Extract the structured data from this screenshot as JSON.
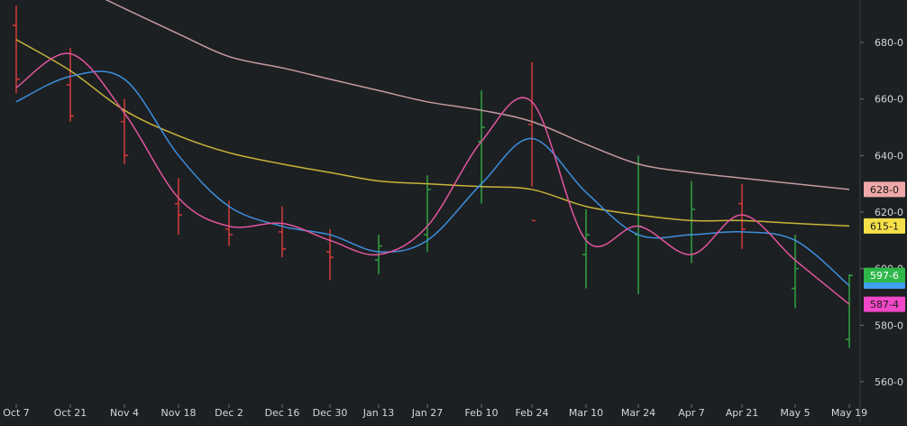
{
  "chart_data": {
    "type": "ohlc",
    "title": "",
    "xlabel": "",
    "ylabel": "",
    "ylim": [
      553,
      700
    ],
    "grid": false,
    "y_ticks": [
      {
        "value": 680,
        "label": "680-0"
      },
      {
        "value": 660,
        "label": "660-0"
      },
      {
        "value": 640,
        "label": "640-0"
      },
      {
        "value": 620,
        "label": "620-0"
      },
      {
        "value": 600,
        "label": "600-0"
      },
      {
        "value": 580,
        "label": "580-0"
      },
      {
        "value": 560,
        "label": "560-0"
      }
    ],
    "x_ticks": [
      "Oct 7",
      "Oct 21",
      "Nov 4",
      "Nov 18",
      "Dec 2",
      "Dec 16",
      "Dec 30",
      "Jan 13",
      "Jan 27",
      "Feb 10",
      "Feb 24",
      "Mar 10",
      "Mar 24",
      "Apr 7",
      "Apr 21",
      "May 5",
      "May 19"
    ],
    "last_value_labels": [
      {
        "label": "628-0",
        "value": 628.0,
        "color": "#f0a8a8"
      },
      {
        "label": "615-1",
        "value": 615.1,
        "color": "#f5e04a"
      },
      {
        "label": "597-6",
        "value": 597.6,
        "color": "#2fb84a"
      },
      {
        "label": "",
        "value": 594.0,
        "color": "#3fa0f0"
      },
      {
        "label": "587-4",
        "value": 587.4,
        "color": "#f048c8"
      }
    ],
    "series": [
      {
        "type": "line",
        "color": "#c49aa0",
        "x": [
          "Oct 7",
          "Oct 21",
          "Nov 4",
          "Nov 18",
          "Dec 2",
          "Dec 16",
          "Dec 30",
          "Jan 13",
          "Jan 27",
          "Feb 10",
          "Feb 24",
          "Mar 10",
          "Mar 24",
          "Apr 7",
          "Apr 21",
          "May 5",
          "May 19"
        ],
        "values": [
          709,
          701,
          692,
          683,
          675,
          671,
          667,
          663,
          659,
          656,
          652,
          644,
          637,
          634,
          632,
          630,
          628
        ]
      },
      {
        "type": "line",
        "color": "#c8b43a",
        "x": [
          "Oct 7",
          "Oct 21",
          "Nov 4",
          "Nov 18",
          "Dec 2",
          "Dec 16",
          "Dec 30",
          "Jan 13",
          "Jan 27",
          "Feb 10",
          "Feb 24",
          "Mar 10",
          "Mar 24",
          "Apr 7",
          "Apr 21",
          "May 5",
          "May 19"
        ],
        "values": [
          681,
          670,
          656,
          647,
          641,
          637,
          634,
          631,
          630,
          629,
          628,
          622,
          619,
          617,
          617,
          616,
          615.1
        ]
      },
      {
        "type": "line",
        "color": "#3d8ede",
        "x": [
          "Oct 7",
          "Oct 21",
          "Nov 4",
          "Nov 18",
          "Dec 2",
          "Dec 16",
          "Dec 30",
          "Jan 13",
          "Jan 27",
          "Feb 10",
          "Feb 24",
          "Mar 10",
          "Mar 24",
          "Apr 7",
          "Apr 21",
          "May 5",
          "May 19"
        ],
        "values": [
          659,
          668,
          667,
          640,
          622,
          615,
          612,
          606,
          610,
          630,
          646,
          627,
          612,
          612,
          613,
          610,
          594
        ]
      },
      {
        "type": "line",
        "color": "#e2559f",
        "x": [
          "Oct 7",
          "Oct 21",
          "Nov 4",
          "Nov 18",
          "Dec 2",
          "Dec 16",
          "Dec 30",
          "Jan 13",
          "Jan 27",
          "Feb 10",
          "Feb 24",
          "Mar 10",
          "Mar 24",
          "Apr 7",
          "Apr 21",
          "May 5",
          "May 19"
        ],
        "values": [
          664,
          676,
          655,
          625,
          615,
          616,
          610,
          605,
          615,
          645,
          659,
          610,
          615,
          605,
          619,
          603,
          587.4
        ]
      },
      {
        "type": "ohlc",
        "up_color": "#2e9a40",
        "down_color": "#c83a3a",
        "x": [
          "Oct 7",
          "Oct 21",
          "Nov 4",
          "Nov 18",
          "Dec 2",
          "Dec 16",
          "Dec 30",
          "Jan 13",
          "Jan 27",
          "Feb 10",
          "Feb 24",
          "Mar 10",
          "Mar 24",
          "Apr 7",
          "Apr 21",
          "May 5",
          "May 19"
        ],
        "open": [
          686,
          665,
          652,
          623,
          614,
          613,
          606,
          603,
          612,
          645,
          651,
          605,
          612,
          612,
          623,
          593,
          575
        ],
        "high": [
          693,
          678,
          660,
          632,
          624,
          622,
          614,
          612,
          633,
          663,
          673,
          621,
          640,
          631,
          630,
          612,
          598
        ],
        "low": [
          662,
          652,
          637,
          612,
          608,
          604,
          596,
          598,
          606,
          623,
          629,
          593,
          591,
          602,
          607,
          586,
          572
        ],
        "close": [
          667,
          654,
          640,
          619,
          612,
          607,
          604,
          608,
          628,
          650,
          617,
          612,
          615,
          621,
          614,
          600,
          597.6
        ]
      }
    ]
  }
}
